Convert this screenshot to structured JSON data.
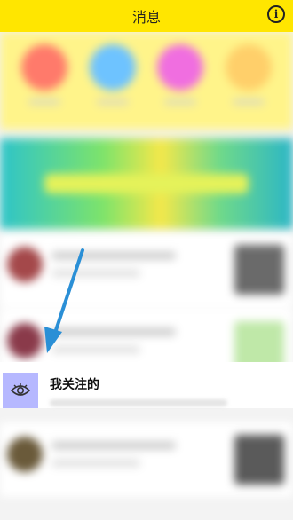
{
  "header": {
    "title": "消息",
    "info_icon": "info-icon"
  },
  "focus_row": {
    "label": "我关注的",
    "icon": "eye-icon"
  },
  "colors": {
    "header_bg": "#ffe600",
    "arrow": "#2a8fd6",
    "eye_box": "#b6b8ff"
  }
}
